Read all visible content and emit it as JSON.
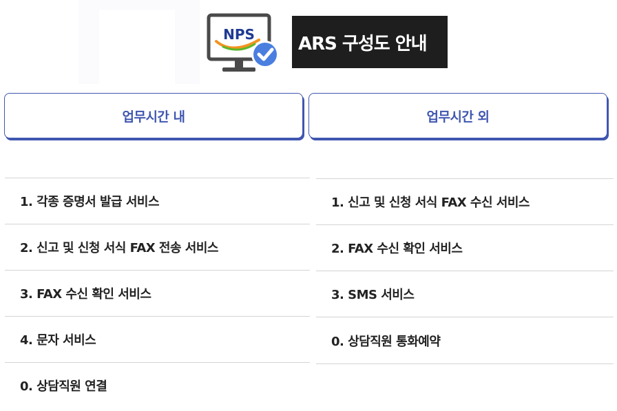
{
  "header": {
    "logo_text": "NPS",
    "title": "ARS 구성도 안내"
  },
  "tabs": [
    {
      "label": "업무시간 내"
    },
    {
      "label": "업무시간 외"
    }
  ],
  "lists": {
    "in_hours": [
      {
        "label": "1. 각종 증명서 발급 서비스"
      },
      {
        "label": "2. 신고 및 신청 서식 FAX 전송 서비스"
      },
      {
        "label": "3. FAX 수신 확인 서비스"
      },
      {
        "label": "4. 문자 서비스"
      },
      {
        "label": "0. 상담직원 연결"
      }
    ],
    "after_hours": [
      {
        "label": "1. 신고 및 신청 서식 FAX 수신 서비스"
      },
      {
        "label": "2. FAX 수신 확인 서비스"
      },
      {
        "label": "3. SMS 서비스"
      },
      {
        "label": "0. 상담직원 통화예약"
      }
    ]
  },
  "colors": {
    "accent": "#3f56b0",
    "title_bg": "#1e1e1e",
    "check_badge": "#4a7fe0",
    "logo_orange": "#f29321",
    "logo_green": "#5cb82a"
  },
  "icons": {
    "logo": "monitor-check-icon"
  }
}
